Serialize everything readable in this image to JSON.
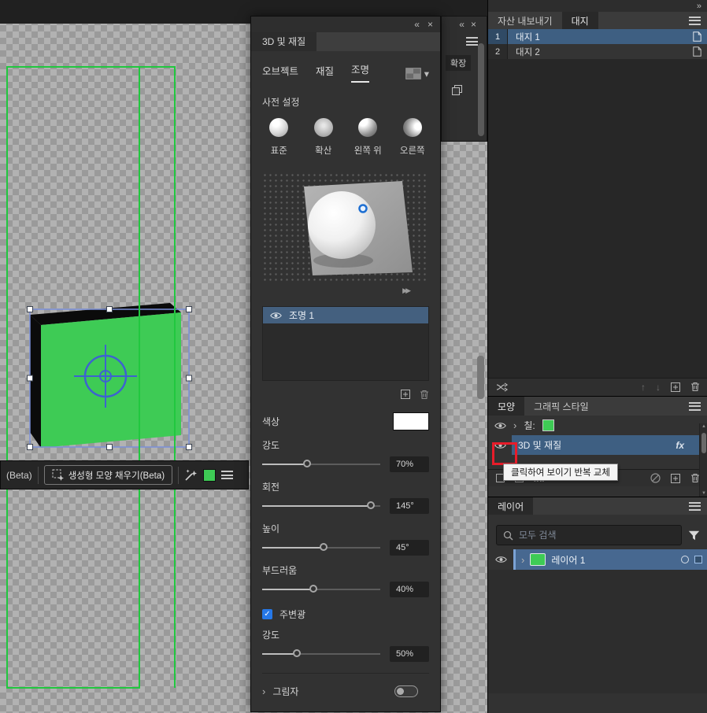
{
  "icons": {
    "more": "»",
    "collapse": "«",
    "close": "×",
    "up_arrow": "↑",
    "down_arrow": "↓",
    "chevron_right": "›",
    "chevron_down": "▾",
    "apply_arrows": "▶▶",
    "check": "✓"
  },
  "options_bar": {
    "beta_label": "(Beta)",
    "generate_button": "생성형 모양 채우기(Beta)"
  },
  "colors": {
    "shape_fill": "#3ecb55",
    "selection_blue": "#3e5f82",
    "guide_green": "#21c73f",
    "annotation_red": "#e81c2a",
    "light_color_swatch": "#ffffff"
  },
  "panel_3d": {
    "title": "3D 및 재질",
    "tabs": [
      {
        "label": "오브젝트"
      },
      {
        "label": "재질"
      },
      {
        "label": "조명"
      }
    ],
    "presets_title": "사전 설정",
    "presets": [
      {
        "label": "표준"
      },
      {
        "label": "확산"
      },
      {
        "label": "왼쪽 위"
      },
      {
        "label": "오른쪽"
      }
    ],
    "lights": [
      {
        "name": "조명 1"
      }
    ],
    "color_label": "색상",
    "sliders": [
      {
        "label": "강도",
        "value": "70%"
      },
      {
        "label": "회전",
        "value": "145°"
      },
      {
        "label": "높이",
        "value": "45°"
      },
      {
        "label": "부드러움",
        "value": "40%"
      }
    ],
    "ambient_checkbox": "주변광",
    "ambient_slider": {
      "label": "강도",
      "value": "50%"
    },
    "shadow_label": "그림자"
  },
  "artboards_panel": {
    "tabs": [
      {
        "label": "자산 내보내기"
      },
      {
        "label": "대지"
      }
    ],
    "rows": [
      {
        "num": "1",
        "name": "대지 1"
      },
      {
        "num": "2",
        "name": "대지 2"
      }
    ]
  },
  "appearance_panel": {
    "tabs": [
      {
        "label": "모양"
      },
      {
        "label": "그래픽 스타일"
      }
    ],
    "fill_label": "칠:",
    "effect_name": "3D 및 재질",
    "fx_badge": "fx",
    "footer_fx": "fx.",
    "tooltip": "클릭하여 보이기 반복 교체"
  },
  "layers_panel": {
    "title": "레이어",
    "search_placeholder": "모두 검색",
    "layers": [
      {
        "name": "레이어 1"
      }
    ]
  },
  "side_strip": {
    "label": "확장"
  }
}
